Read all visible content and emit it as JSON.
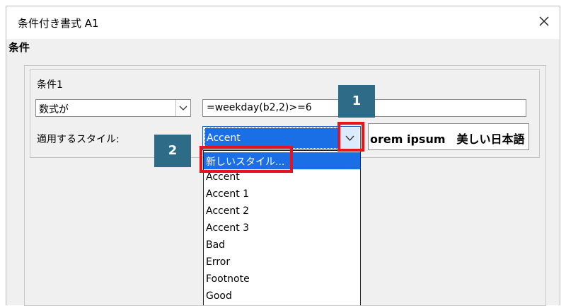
{
  "dialog": {
    "title": "条件付き書式 A1"
  },
  "section": {
    "label": "条件"
  },
  "condition": {
    "title": "条件1",
    "type_value": "数式が",
    "formula_value": "=weekday(b2,2)>=6",
    "style_label": "適用するスタイル:",
    "style_value": "Accent",
    "preview_text": "orem ipsum　美しい日本語"
  },
  "dropdown": {
    "items": [
      "新しいスタイル...",
      "Accent",
      "Accent 1",
      "Accent 2",
      "Accent 3",
      "Bad",
      "Error",
      "Footnote",
      "Good"
    ],
    "highlighted_index": 0
  },
  "callouts": {
    "badge1": "1",
    "badge2": "2"
  },
  "colors": {
    "highlight": "#1a6ee6",
    "badge": "#2d6b86",
    "callout_red": "#e8131b"
  }
}
